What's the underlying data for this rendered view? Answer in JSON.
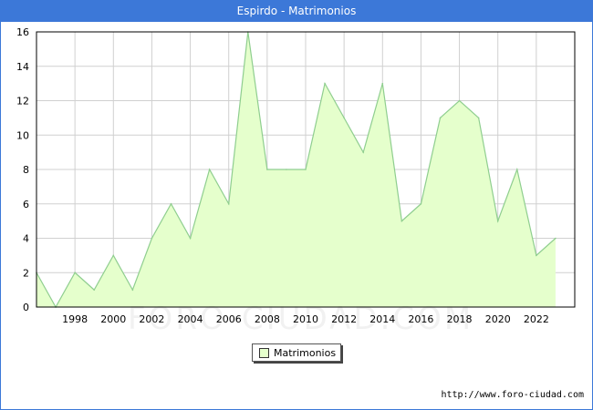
{
  "window": {
    "title": "Espirdo - Matrimonios"
  },
  "watermark": "FORO-CIUDAD.COM",
  "source": "http://www.foro-ciudad.com",
  "colors": {
    "title_bar": "#3c78d8",
    "fill": "#e5ffcc",
    "line": "#8fce8f",
    "grid": "#d0d0d0"
  },
  "chart_data": {
    "type": "area",
    "title": "Espirdo - Matrimonios",
    "xlabel": "",
    "ylabel": "",
    "x": [
      1996,
      1997,
      1998,
      1999,
      2000,
      2001,
      2002,
      2003,
      2004,
      2005,
      2006,
      2007,
      2008,
      2009,
      2010,
      2011,
      2012,
      2013,
      2014,
      2015,
      2016,
      2017,
      2018,
      2019,
      2020,
      2021,
      2022,
      2023
    ],
    "series": [
      {
        "name": "Matrimonios",
        "values": [
          2,
          0,
          2,
          1,
          3,
          1,
          4,
          6,
          4,
          8,
          6,
          16,
          8,
          8,
          8,
          13,
          11,
          9,
          13,
          5,
          6,
          11,
          12,
          11,
          5,
          8,
          3,
          4
        ]
      }
    ],
    "xlim": [
      1996,
      2024
    ],
    "ylim": [
      0,
      16
    ],
    "x_ticks": [
      "1998",
      "2000",
      "2002",
      "2004",
      "2006",
      "2008",
      "2010",
      "2012",
      "2014",
      "2016",
      "2018",
      "2020",
      "2022"
    ],
    "y_ticks": [
      "0",
      "2",
      "4",
      "6",
      "8",
      "10",
      "12",
      "14",
      "16"
    ],
    "grid": true,
    "legend_position": "bottom-center"
  }
}
